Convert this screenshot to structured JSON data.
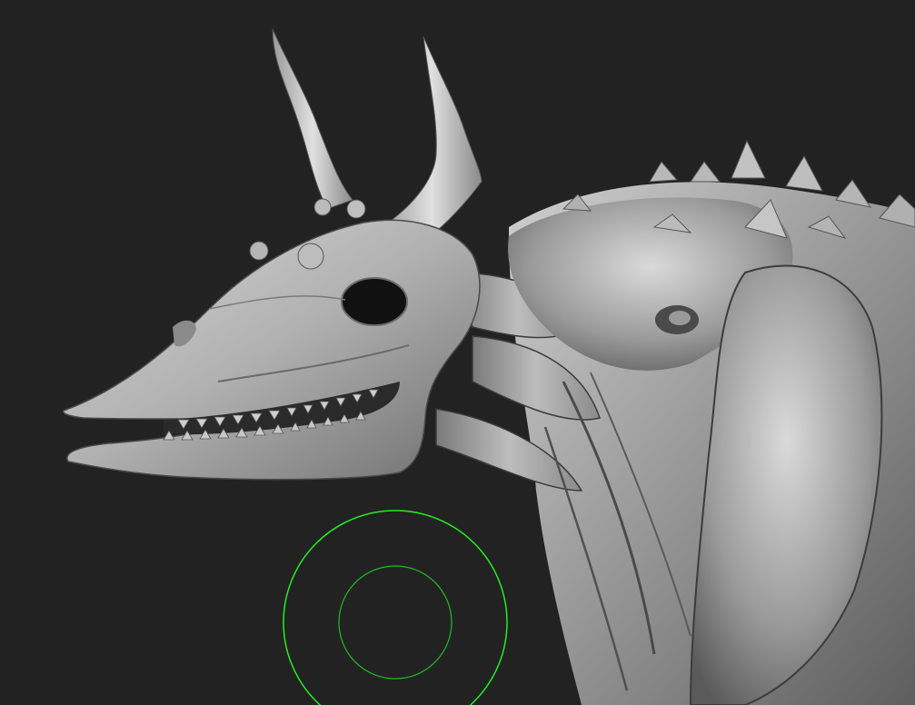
{
  "viewport": {
    "background": "#222222"
  },
  "model": {
    "material_color": "#a9a9a9",
    "shadow_color": "#4a4a4a",
    "highlight_color": "#e6e6e6"
  },
  "brush_cursor": {
    "color": "#22ee22",
    "icon": "brush-circle-icon"
  }
}
